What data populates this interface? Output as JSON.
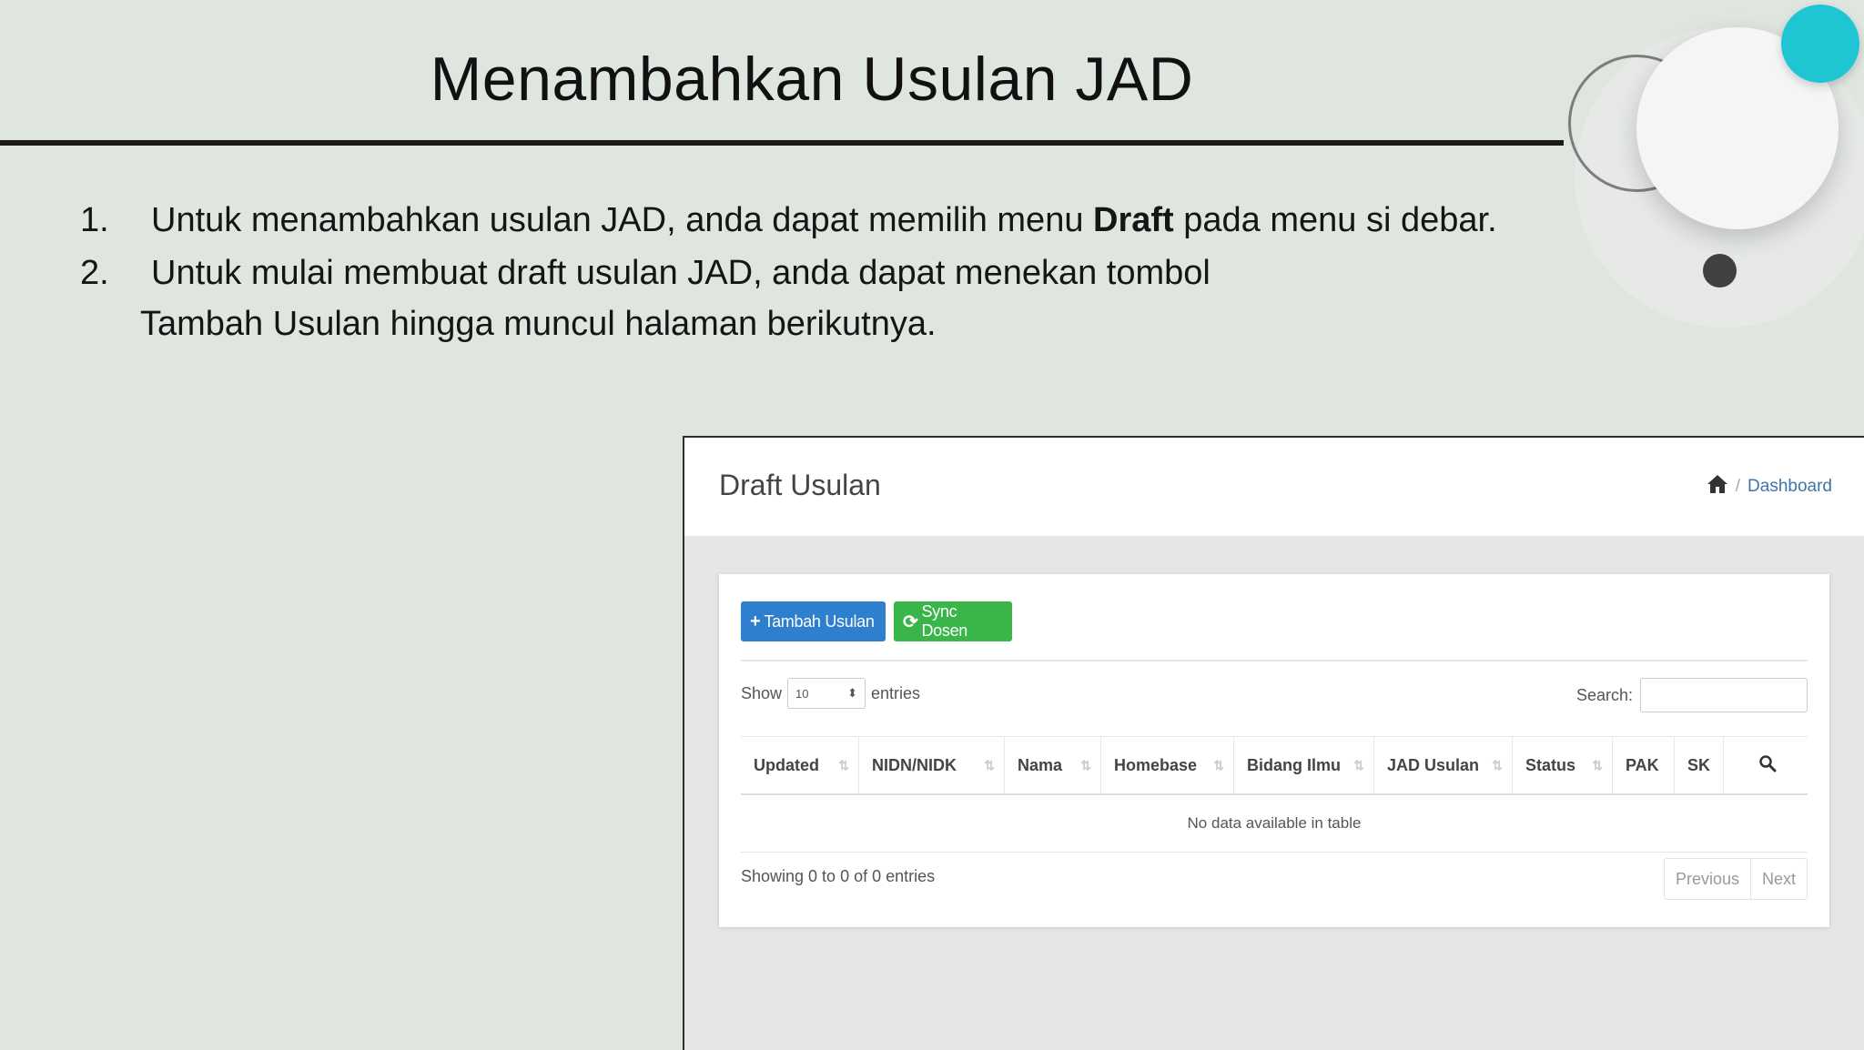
{
  "slide": {
    "title": "Menambahkan Usulan JAD",
    "items": [
      {
        "num": "1.",
        "text_before": "Untuk menambahkan usulan JAD, anda dapat memilih menu ",
        "bold": "Draft",
        "text_after": " pada menu si debar."
      },
      {
        "num": "2.",
        "line1": "Untuk mulai membuat draft usulan JAD, anda dapat menekan tombol",
        "line2": "Tambah Usulan hingga muncul halaman berikutnya."
      }
    ]
  },
  "app": {
    "page_title": "Draft Usulan",
    "breadcrumb": {
      "home_icon": "home-icon",
      "sep": "/",
      "current": "Dashboard"
    },
    "buttons": {
      "add": {
        "glyph": "+",
        "label": "Tambah Usulan",
        "color": "#2f7fcf"
      },
      "sync": {
        "glyph": "⟳",
        "label": "Sync Dosen",
        "color": "#39b54a"
      }
    },
    "length": {
      "show_label": "Show",
      "value": "10",
      "entries_label": "entries"
    },
    "search_label": "Search:",
    "table": {
      "columns": [
        "Updated",
        "NIDN/NIDK",
        "Nama",
        "Homebase",
        "Bidang Ilmu",
        "JAD Usulan",
        "Status",
        "PAK",
        "SK"
      ],
      "empty_message": "No data available in table"
    },
    "info": "Showing 0 to 0 of 0 entries",
    "pagination": {
      "previous": "Previous",
      "next": "Next"
    }
  }
}
